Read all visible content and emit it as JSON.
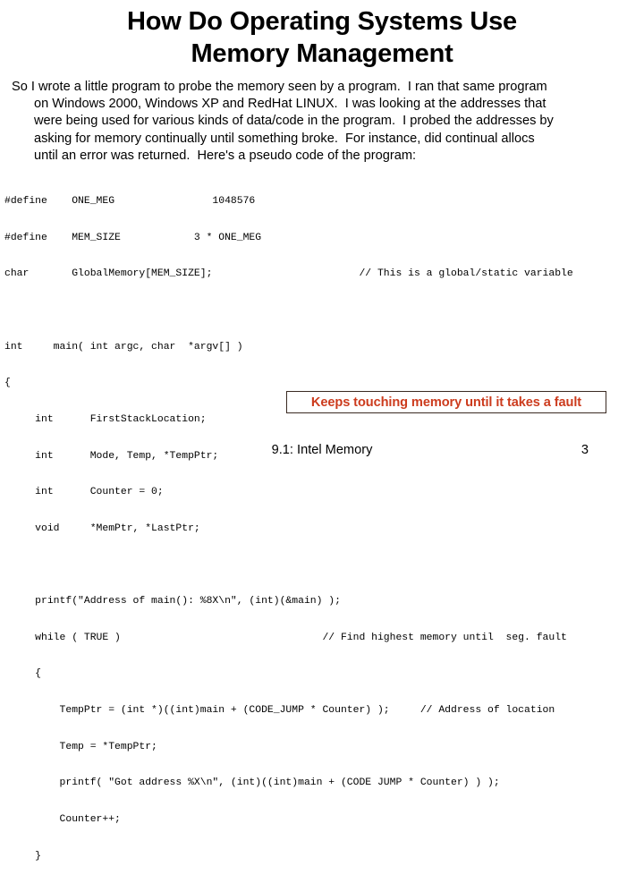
{
  "title": {
    "line1": "How Do Operating Systems Use",
    "line2": "Memory Management"
  },
  "body": {
    "line1": "So I wrote a little program to probe the memory seen by a program.  I ran that same program",
    "line2": "on Windows 2000, Windows XP and RedHat LINUX.  I was looking at the addresses that",
    "line3": "were being used for various kinds of data/code in the program.  I probed the addresses by",
    "line4": "asking for memory continually until something broke.  For instance, did continual allocs",
    "line5": "until an error was returned.  Here's a pseudo code of the program:"
  },
  "code": {
    "lines": [
      "#define    ONE_MEG                1048576",
      "#define    MEM_SIZE            3 * ONE_MEG",
      "char       GlobalMemory[MEM_SIZE];                        // This is a global/static variable",
      "",
      "int     main( int argc, char  *argv[] )",
      "{",
      "     int      FirstStackLocation;",
      "     int      Mode, Temp, *TempPtr;",
      "     int      Counter = 0;",
      "     void     *MemPtr, *LastPtr;",
      "",
      "     printf(\"Address of main(): %8X\\n\", (int)(&main) );",
      "     while ( TRUE )                                 // Find highest memory until  seg. fault",
      "     {",
      "         TempPtr = (int *)((int)main + (CODE_JUMP * Counter) );     // Address of location",
      "         Temp = *TempPtr;",
      "         printf( \"Got address %X\\n\", (int)((int)main + (CODE JUMP * Counter) ) );",
      "         Counter++;",
      "     }"
    ]
  },
  "callout": {
    "text": "Keeps touching memory until it takes a fault",
    "text_color": "#cc3b1d",
    "border_color": "#3a2a22"
  },
  "footer": {
    "section": "9.1: Intel Memory",
    "page_number": "3"
  }
}
